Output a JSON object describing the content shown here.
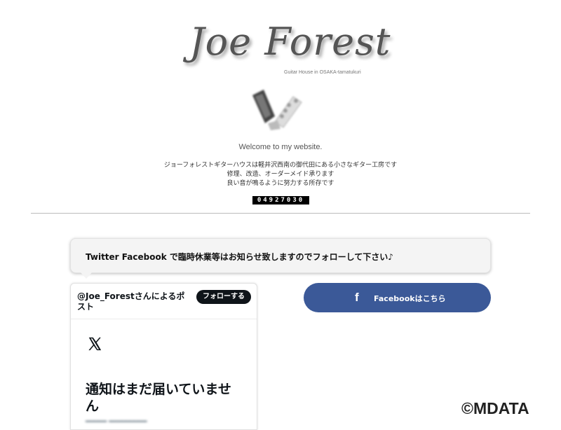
{
  "header": {
    "logo_text": "Joe Forest",
    "logo_subtitle": "Guitar House in OSAKA-tamatukuri",
    "welcome": "Welcome to my website.",
    "intro_lines": [
      "ジョーフォレストギターハウスは軽井沢西南の御代田にある小さなギター工房です",
      "修理、改造、オーダーメイド承ります",
      "良い音が鳴るように努力する所存です"
    ],
    "visitor_counter": "04927030"
  },
  "notice": {
    "text": "Twitter Facebook で臨時休業等はお知らせ致しますのでフォローして下さい♪"
  },
  "twitter_widget": {
    "title": "@Joe_Forestさんによるポスト",
    "follow_label": "フォローする",
    "empty_title": "通知はまだ届いていません",
    "icon": "x-logo-icon"
  },
  "facebook_button": {
    "label": "Facebookはこちら",
    "icon": "facebook-icon",
    "color": "#3b5998"
  },
  "watermark": "©MDATA"
}
